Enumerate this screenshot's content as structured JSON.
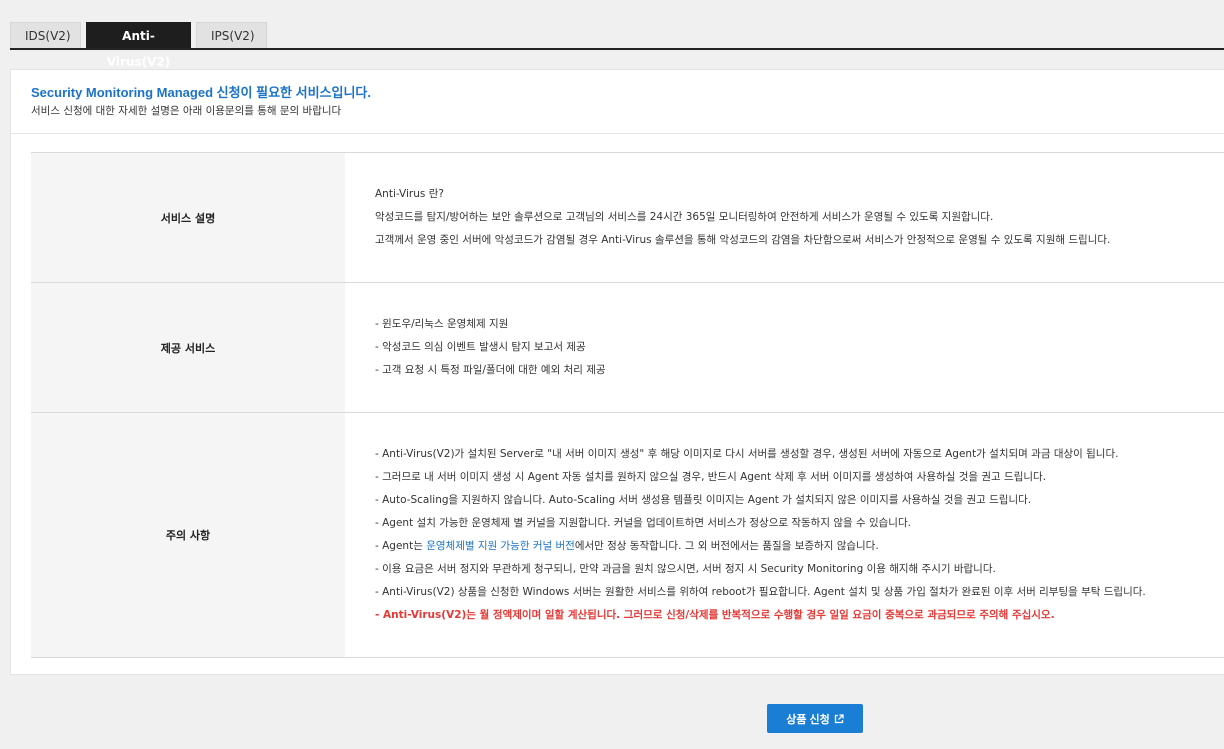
{
  "tabs": [
    {
      "label": "IDS(V2)",
      "active": false
    },
    {
      "label": "Anti-Virus(V2)",
      "active": true
    },
    {
      "label": "IPS(V2)",
      "active": false
    }
  ],
  "header": {
    "title": "Security Monitoring Managed 신청이 필요한 서비스입니다.",
    "subtitle": "서비스 신청에 대한 자세한 설명은 아래 이용문의를 통해 문의 바랍니다"
  },
  "sections": {
    "description": {
      "label": "서비스 설명",
      "lines": [
        "Anti-Virus 란?",
        "악성코드를 탐지/방어하는 보안 솔루션으로 고객님의 서비스를 24시간 365일 모니터링하여 안전하게 서비스가 운영될 수 있도록 지원합니다.",
        "고객께서 운영 중인 서버에 악성코드가 감염될 경우 Anti-Virus 솔루션을 통해 악성코드의 감염을 차단함으로써 서비스가 안정적으로 운영될 수 있도록 지원해 드립니다."
      ]
    },
    "provided": {
      "label": "제공 서비스",
      "lines": [
        "- 윈도우/리눅스 운영체제 지원",
        "- 악성코드 의심 이벤트 발생시 탐지 보고서 제공",
        "- 고객 요청 시 특정 파일/폴더에 대한 예외 처리 제공"
      ]
    },
    "notes": {
      "label": "주의 사항",
      "lines": [
        "- Anti-Virus(V2)가 설치된 Server로 \"내 서버 이미지 생성\" 후 해당 이미지로 다시 서버를 생성할 경우, 생성된 서버에 자동으로 Agent가 설치되며 과금 대상이 됩니다.",
        "- 그러므로 내 서버 이미지 생성 시 Agent 자동 설치를 원하지 않으실 경우, 반드시 Agent 삭제 후 서버 이미지를 생성하여 사용하실 것을 권고 드립니다.",
        "- Auto-Scaling을 지원하지 않습니다. Auto-Scaling 서버 생성용 템플릿 이미지는 Agent 가 설치되지 않은 이미지를 사용하실 것을 권고 드립니다.",
        "- Agent 설치 가능한 운영체제 별 커널을 지원합니다. 커널을 업데이트하면 서비스가 정상으로 작동하지 않을 수 있습니다."
      ],
      "link_line": {
        "before": "- Agent는 ",
        "link": "운영체제별 지원 가능한 커널 버전",
        "after": "에서만 정상 동작합니다. 그 외 버전에서는 품질을 보증하지 않습니다."
      },
      "lines_after": [
        "- 이용 요금은 서버 정지와 무관하게 청구되니, 만약 과금을 원치 않으시면, 서버 정지 시 Security Monitoring 이용 해지해 주시기 바랍니다.",
        "- Anti-Virus(V2) 상품을 신청한 Windows 서버는 원활한 서비스를 위하여 reboot가 필요합니다. Agent 설치 및 상품 가입 절차가 완료된 이후 서버 리부팅을 부탁 드립니다."
      ],
      "warning": "- Anti-Virus(V2)는 월 정액제이며 일할 계산됩니다. 그러므로 신청/삭제를 반복적으로 수행할 경우 일일 요금이 중복으로 과금되므로 주의해 주십시오."
    }
  },
  "apply_button": {
    "label": "상품 신청",
    "icon": "external-link-icon"
  },
  "colors": {
    "accent": "#1a73c8",
    "button": "#1a7fd4",
    "warning": "#e53935",
    "active_tab": "#1e1e1e"
  }
}
